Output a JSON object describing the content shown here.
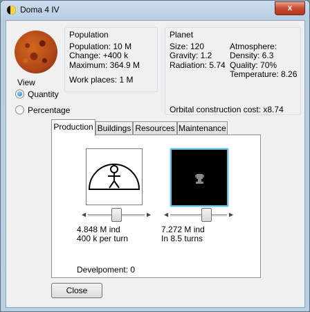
{
  "window": {
    "title": "Doma 4 IV",
    "close_label": "x"
  },
  "view": {
    "label": "View",
    "options": [
      "Quantity",
      "Percentage"
    ],
    "selected": "Quantity"
  },
  "population": {
    "header": "Population",
    "population": "Population: 10 M",
    "change": "Change: +400 k",
    "maximum": "Maximum: 364.9 M",
    "work_places": "Work places: 1 M"
  },
  "planet": {
    "header": "Planet",
    "size": "Size: 120",
    "gravity": "Gravity: 1.2",
    "radiation": "Radiation: 5.74",
    "atmosphere": "Atmosphere:",
    "density": "Density: 6.3",
    "quality": "Quality: 70%",
    "temperature": "Temperature: 8.26",
    "orbital_cost": "Orbital construction cost: x8.74"
  },
  "tabs": [
    "Production",
    "Buildings",
    "Resources",
    "Maintenance"
  ],
  "active_tab": "Production",
  "production": {
    "left_value": "4.848 M ind",
    "left_rate": "400 k per turn",
    "left_slider_fraction": 0.5,
    "right_value": "7.272 M ind",
    "right_rate": "In 8.5 turns",
    "right_slider_fraction": 0.67,
    "development": "Develpoment: 0"
  },
  "buttons": {
    "close": "Close"
  },
  "icons": {
    "app": "moon-icon",
    "population": "person-dome-icon",
    "building": "trophy-icon"
  }
}
